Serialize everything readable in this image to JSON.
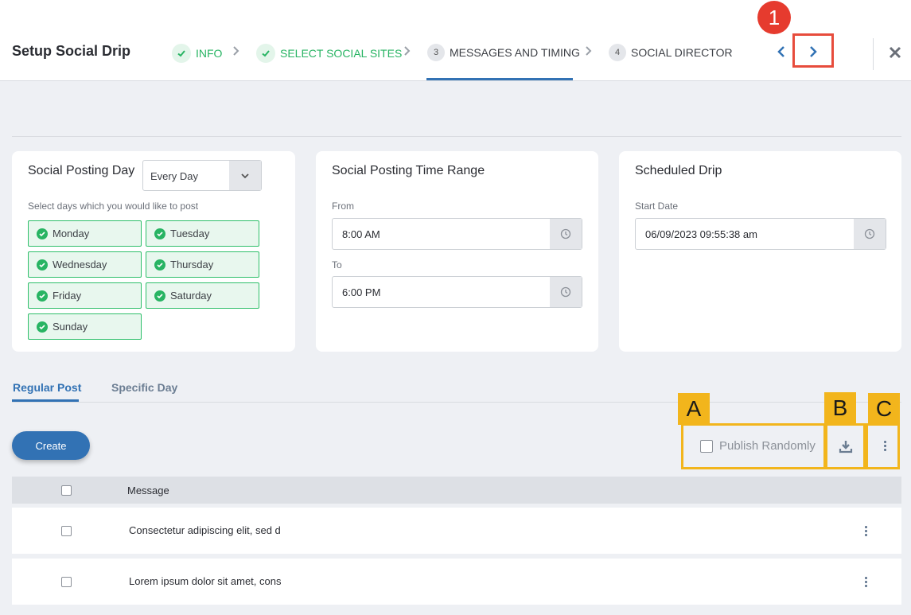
{
  "header": {
    "title": "Setup Social Drip",
    "steps": [
      {
        "label": "INFO",
        "state": "done"
      },
      {
        "label": "SELECT SOCIAL SITES",
        "state": "done"
      },
      {
        "label": "MESSAGES AND TIMING",
        "number": "3",
        "state": "active"
      },
      {
        "label": "SOCIAL DIRECTOR",
        "number": "4",
        "state": "todo"
      }
    ],
    "annotation_badge": "1"
  },
  "posting_day": {
    "title": "Social Posting Day",
    "select_value": "Every Day",
    "hint": "Select days which you would like to post",
    "days": [
      "Monday",
      "Tuesday",
      "Wednesday",
      "Thursday",
      "Friday",
      "Saturday",
      "Sunday"
    ]
  },
  "time_range": {
    "title": "Social Posting Time Range",
    "from_label": "From",
    "from_value": "8:00 AM",
    "to_label": "To",
    "to_value": "6:00 PM"
  },
  "scheduled": {
    "title": "Scheduled Drip",
    "start_label": "Start Date",
    "start_value": "06/09/2023 09:55:38 am"
  },
  "tabs": [
    "Regular Post",
    "Specific Day"
  ],
  "toolbar": {
    "create_label": "Create",
    "publish_randomly": "Publish Randomly",
    "labels": [
      "A",
      "B",
      "C"
    ]
  },
  "table": {
    "header": "Message",
    "rows": [
      "Consectetur adipiscing elit, sed d",
      "Lorem ipsum dolor sit amet, cons"
    ]
  },
  "colors": {
    "accent": "#3272b4",
    "success": "#28b463",
    "annotation_yellow": "#f2b51c",
    "annotation_red": "#e74c3c"
  }
}
